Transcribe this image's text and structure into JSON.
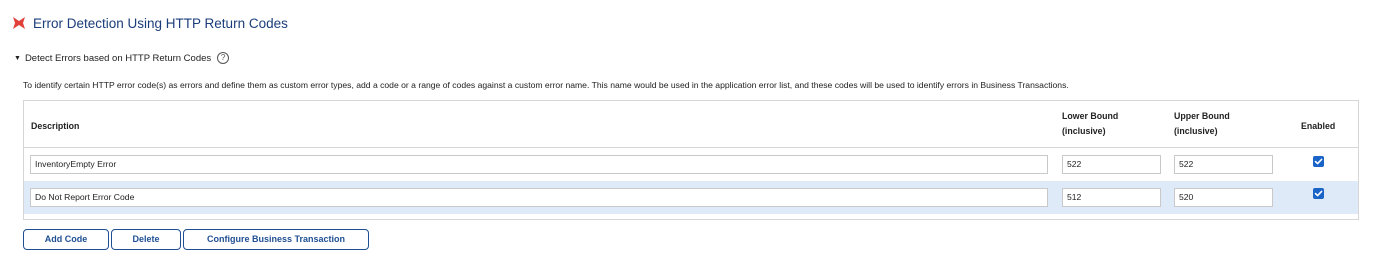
{
  "header": {
    "title": "Error Detection Using HTTP Return Codes",
    "icon": "bowtie-icon",
    "icon_color": "#e0413a"
  },
  "section": {
    "label": "Detect Errors based on HTTP Return Codes",
    "help_icon": "question-circle-icon"
  },
  "description": "To identify certain HTTP error code(s) as errors and define them as custom error types, add a code or a range of codes against a custom error name. This name would be used in the application error list, and these codes will be used to identify errors in Business Transactions.",
  "table": {
    "headers": {
      "description": "Description",
      "lower_line1": "Lower Bound",
      "lower_line2": "(inclusive)",
      "upper_line1": "Upper Bound",
      "upper_line2": "(inclusive)",
      "enabled": "Enabled"
    },
    "rows": [
      {
        "description": "InventoryEmpty Error",
        "lower": "522",
        "upper": "522",
        "enabled": true
      },
      {
        "description": "Do Not Report Error Code",
        "lower": "512",
        "upper": "520",
        "enabled": true
      }
    ]
  },
  "buttons": {
    "add": "Add Code",
    "delete": "Delete",
    "configure": "Configure Business Transaction"
  },
  "colors": {
    "accent": "#1a64c8",
    "button_border": "#1f4f93",
    "selected_row": "#dfeaf8"
  }
}
